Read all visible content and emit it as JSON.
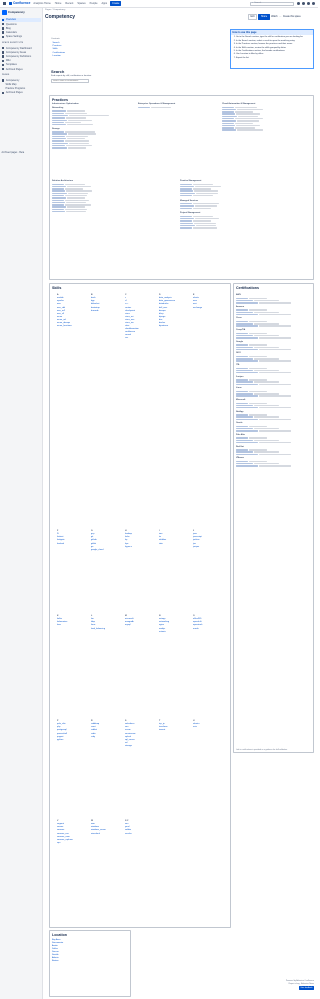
{
  "topbar": {
    "brand": "Confluence",
    "nav": [
      "Analytics Home",
      "Home",
      "Recent",
      "Spaces",
      "People",
      "Apps"
    ],
    "create_label": "Create",
    "search_placeholder": "Search"
  },
  "sidebar": {
    "space_name": "Competency",
    "items": [
      {
        "label": "Overview"
      },
      {
        "label": "Questions"
      },
      {
        "label": "Blog"
      },
      {
        "label": "Calendars"
      },
      {
        "label": "Space Settings"
      }
    ],
    "shortcuts_heading": "SPACE SHORTCUTS",
    "shortcuts": [
      "Competency Dashboard",
      "Competency Areas",
      "Competency Definitions",
      "Wiki",
      "Templates",
      "Archived Pages"
    ],
    "pages_heading": "PAGES",
    "pages": [
      "Competency",
      "Skills Map",
      "Practice Programs",
      "Archived Pages"
    ],
    "footer": "Archived pages · Beta"
  },
  "page": {
    "breadcrumb": "Pages / Competency",
    "title": "Competency",
    "actions": {
      "edit": "Edit",
      "share": "Share",
      "watch": "Watch",
      "more": "···",
      "create_space": "Create this space"
    }
  },
  "info": {
    "title": "How to use this page",
    "steps": [
      "Go to the Search section, type the skill or certification you are looking for.",
      "In the Search section, select a result to open the matching entry.",
      "In the Practices section, browse the practices and their areas.",
      "In the Skills section, review the skills grouped by letter.",
      "In the Certifications section, find vendor certifications.",
      "Use Location to filter by office.",
      "Export the list."
    ]
  },
  "toc": {
    "label": "Contents",
    "items": [
      "Search",
      "Practices",
      "Skills",
      "Certifications",
      "Location"
    ]
  },
  "search": {
    "heading": "Search",
    "description": "Find experts by skill, certification or location.",
    "placeholder": "Search skills or certifications"
  },
  "practices": {
    "heading": "Practices",
    "groups": [
      {
        "title": "Infrastructure Optimization",
        "sub": [
          "Networking",
          "Storage"
        ]
      },
      {
        "title": "Enterprise Operations & Management",
        "sub": []
      },
      {
        "title": "Cloud Automation & Management",
        "sub": []
      },
      {
        "title": "Solution Architecture",
        "sub": []
      },
      {
        "title": "Practice Management",
        "sub": [
          "Managed Services",
          "Project Management"
        ]
      }
    ]
  },
  "skills": {
    "heading": "Skills",
    "columns": [
      {
        "head": "A",
        "items": [
          "ansible",
          "apache",
          "aws",
          "aws_cdk",
          "aws_ec2",
          "aws_s3",
          "azure",
          "azure_ad",
          "azure_devops",
          "azure_functions"
        ]
      },
      {
        "head": "B",
        "items": [
          "bash",
          "bgp",
          "bitbucket",
          "bootstrap",
          "brocade"
        ]
      },
      {
        "head": "C",
        "items": [
          "c",
          "c#",
          "c++",
          "centos",
          "checkpoint",
          "cisco",
          "cisco_aci",
          "cisco_asa",
          "cisco_ios",
          "citrix",
          "cloudformation",
          "confluence",
          "consul",
          "css"
        ]
      },
      {
        "head": "D",
        "items": [
          "data_analysis",
          "data_governance",
          "databricks",
          "dell_emc",
          "devops",
          "dhcp",
          "django",
          "dns",
          "docker",
          "dynatrace"
        ]
      },
      {
        "head": "E",
        "items": [
          "elastic",
          "ems",
          "esxi",
          "exchange"
        ]
      },
      {
        "head": "F",
        "items": [
          "f5",
          "fortinet",
          "fortigate",
          "freebsd"
        ]
      },
      {
        "head": "G",
        "items": [
          "gcp",
          "git",
          "github",
          "gitlab",
          "go",
          "google_cloud"
        ]
      },
      {
        "head": "H",
        "items": [
          "hadoop",
          "helm",
          "hp",
          "hpe",
          "hyper-v"
        ]
      },
      {
        "head": "I",
        "items": [
          "iam",
          "iis",
          "infoblox",
          "istio"
        ]
      },
      {
        "head": "J",
        "items": [
          "java",
          "javascript",
          "jenkins",
          "jira",
          "juniper"
        ]
      },
      {
        "head": "K",
        "items": [
          "kafka",
          "kubernetes",
          "kvm"
        ]
      },
      {
        "head": "L",
        "items": [
          "lan",
          "ldap",
          "linux",
          "load_balancing"
        ]
      },
      {
        "head": "M",
        "items": [
          "microsoft",
          "mongodb",
          "mysql"
        ]
      },
      {
        "head": "N",
        "items": [
          "netapp",
          "networking",
          "nginx",
          "nodejs",
          "nutanix"
        ]
      },
      {
        "head": "O",
        "items": [
          "office365",
          "openshift",
          "openstack",
          "oracle"
        ]
      },
      {
        "head": "P",
        "items": [
          "palo_alto",
          "php",
          "postgresql",
          "powershell",
          "puppet",
          "python"
        ]
      },
      {
        "head": "R",
        "items": [
          "rabbitmq",
          "react",
          "redhat",
          "redis",
          "ruby"
        ]
      },
      {
        "head": "S",
        "items": [
          "salesforce",
          "san",
          "scrum",
          "servicenow",
          "splunk",
          "sql_server",
          "ssl",
          "storage"
        ]
      },
      {
        "head": "T",
        "items": [
          "tcp_ip",
          "terraform",
          "tomcat"
        ]
      },
      {
        "head": "U",
        "items": [
          "ubuntu",
          "unix"
        ]
      },
      {
        "head": "V",
        "items": [
          "vagrant",
          "veeam",
          "vmware",
          "vmware_nsx",
          "vmware_vsan",
          "vmware_vsphere",
          "vpn"
        ]
      },
      {
        "head": "W",
        "items": [
          "wan",
          "windows",
          "windows_server",
          "wireshark"
        ]
      },
      {
        "head": "X-Z",
        "items": [
          "xen",
          "yaml",
          "zabbix",
          "zscaler"
        ]
      }
    ]
  },
  "certifications": {
    "heading": "Certifications",
    "vendors": [
      "AWS",
      "Amazon",
      "Cisco",
      "CompTIA",
      "Google",
      "ISC2",
      "ITIL",
      "Juniper",
      "Linux",
      "Microsoft",
      "NetApp",
      "Oracle",
      "Palo Alto",
      "Red Hat",
      "VMware"
    ],
    "note": "Link to certifications is provided as a guidance for skill validation."
  },
  "location": {
    "heading": "Location",
    "items": [
      "Bay Area",
      "Sacramento",
      "Austin",
      "Dallas",
      "Denver",
      "Seattle",
      "Atlanta",
      "Boston"
    ]
  },
  "footer": {
    "line1": "Powered by Atlassian Confluence",
    "line2": "Report a bug · Atlassian News",
    "feedback_label": "Give feedback"
  },
  "colors": {
    "accent": "#0052cc",
    "panel_border": "#c1c7d0",
    "info_border": "#4c9aff"
  }
}
